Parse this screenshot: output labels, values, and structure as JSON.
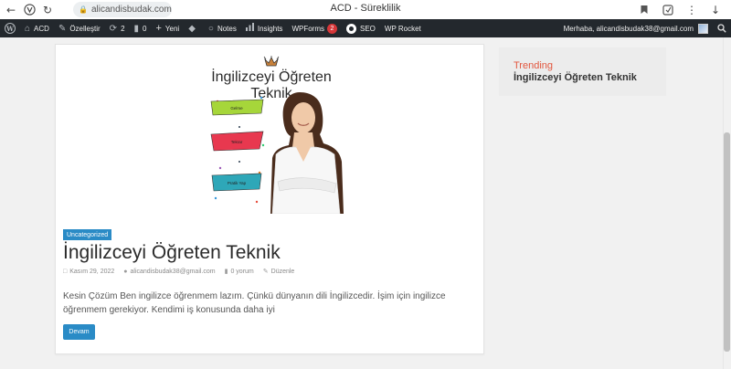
{
  "browser": {
    "url": "alicandisbudak.com",
    "title": "ACD - Süreklilik"
  },
  "adminbar": {
    "site_name": "ACD",
    "customize": "Özelleştir",
    "updates_count": "2",
    "comments_count": "0",
    "new_label": "Yeni",
    "notes_label": "Notes",
    "insights_label": "Insights",
    "wpforms_label": "WPForms",
    "wpforms_badge": "2",
    "seo_label": "SEO",
    "rocket_label": "WP Rocket",
    "greeting": "Merhaba, alicandisbudak38@gmail.com"
  },
  "hero": {
    "title": "İngilizceyi Öğreten Teknik",
    "labels": [
      "Gelme",
      "Tekrar",
      "Pratik Yap"
    ]
  },
  "post": {
    "category": "Uncategorized",
    "title": "İngilizceyi Öğreten Teknik",
    "date": "Kasım 29, 2022",
    "author": "alicandisbudak38@gmail.com",
    "comments": "0 yorum",
    "edit": "Düzenle",
    "excerpt": "Kesin Çözüm Ben ingilizce öğrenmem lazım. Çünkü dünyanın dili İngilizcedir. İşim için ingilizce öğrenmem gerekiyor. Kendimi iş konusunda daha iyi",
    "button": "Devam"
  },
  "sidebar": {
    "trending_label": "Trending",
    "trending_title": "İngilizceyi Öğreten Teknik"
  },
  "colors": {
    "accent": "#2a8bc6",
    "trending": "#e2573f",
    "adminbar": "#23282d"
  }
}
